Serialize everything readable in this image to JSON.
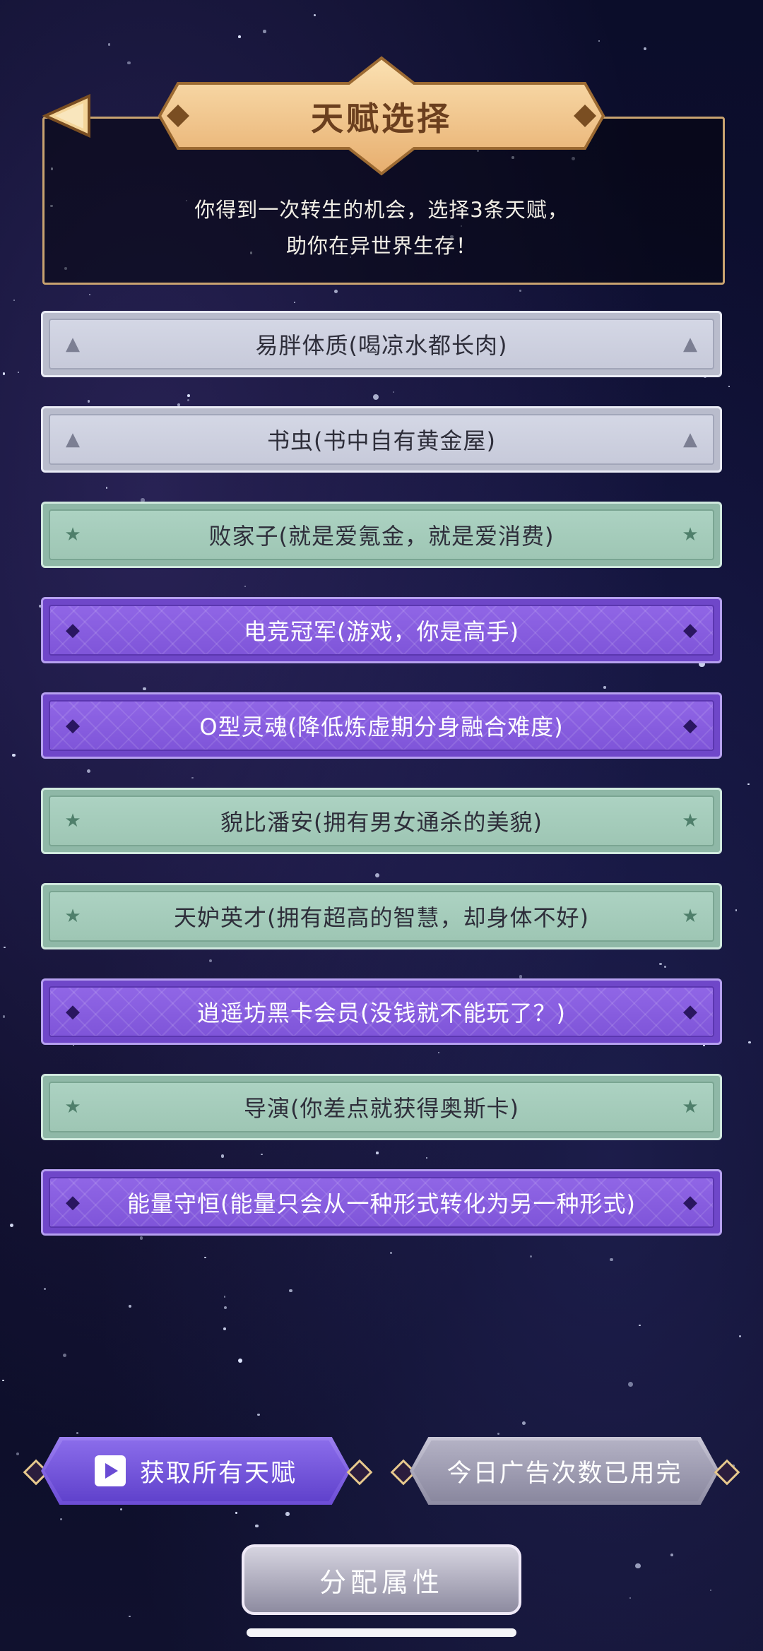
{
  "header": {
    "title": "天赋选择",
    "intro_line1": "你得到一次转生的机会，选择3条天赋，",
    "intro_line2": "助你在异世界生存！"
  },
  "talents": [
    {
      "label": "易胖体质(喝凉水都长肉)",
      "rarity": "white",
      "icon": "triangle-icon"
    },
    {
      "label": "书虫(书中自有黄金屋)",
      "rarity": "white",
      "icon": "triangle-icon"
    },
    {
      "label": "败家子(就是爱氪金，就是爱消费)",
      "rarity": "green",
      "icon": "star-icon"
    },
    {
      "label": "电竞冠军(游戏，你是高手)",
      "rarity": "purple",
      "icon": "gem-icon"
    },
    {
      "label": "O型灵魂(降低炼虚期分身融合难度)",
      "rarity": "purple",
      "icon": "gem-icon"
    },
    {
      "label": "貌比潘安(拥有男女通杀的美貌)",
      "rarity": "green",
      "icon": "star-icon"
    },
    {
      "label": "天妒英才(拥有超高的智慧，却身体不好)",
      "rarity": "green",
      "icon": "star-icon"
    },
    {
      "label": "逍遥坊黑卡会员(没钱就不能玩了？)",
      "rarity": "purple",
      "icon": "gem-icon"
    },
    {
      "label": "导演(你差点就获得奥斯卡)",
      "rarity": "green",
      "icon": "star-icon"
    },
    {
      "label": "能量守恒(能量只会从一种形式转化为另一种形式)",
      "rarity": "purple",
      "icon": "gem-icon"
    }
  ],
  "buttons": {
    "get_all": "获取所有天赋",
    "ads_used": "今日广告次数已用完",
    "allocate": "分配属性"
  },
  "colors": {
    "gold_accent": "#c9a370",
    "purple_rarity": "#7f55d9",
    "green_rarity": "#9ec6b4",
    "white_rarity": "#c7cada"
  }
}
